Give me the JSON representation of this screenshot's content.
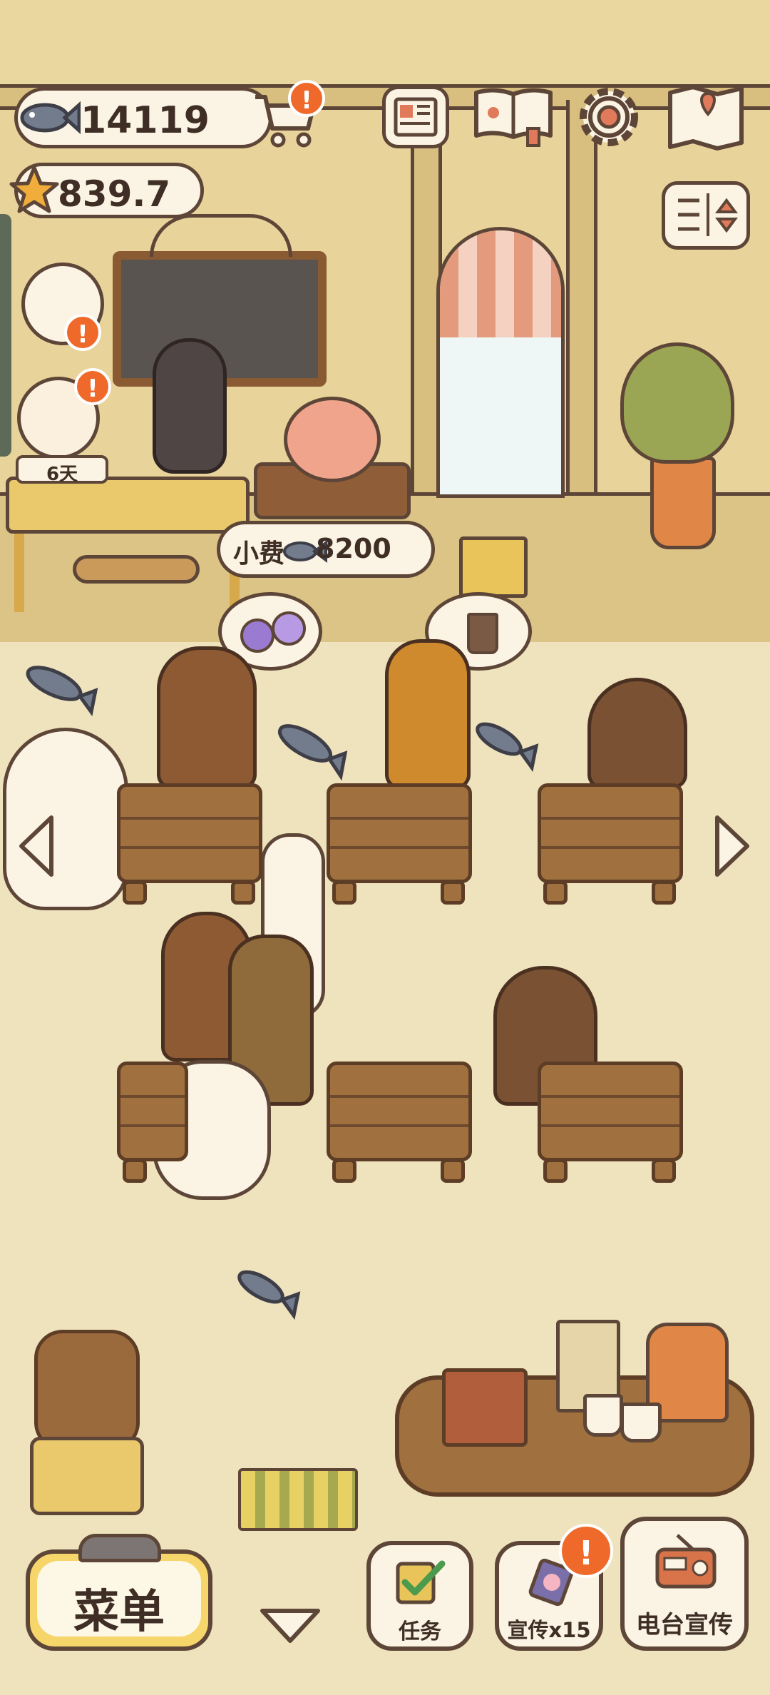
{
  "currency": {
    "fish_count": "14119",
    "stars": "839.7"
  },
  "header_icons": [
    "shop-cart-icon",
    "newspaper-icon",
    "paw-book-icon",
    "gear-icon",
    "map-icon",
    "sort-arrows-icon"
  ],
  "badges": {
    "alert": "!"
  },
  "calendar": {
    "days_label": "6天"
  },
  "tip": {
    "label": "小费",
    "amount": "8200"
  },
  "order_bubbles": [
    "mochi-order-icon",
    "coffee-order-icon"
  ],
  "bottom_bar": {
    "menu_label": "菜单",
    "tasks_label": "任务",
    "promo_label": "宣传x15",
    "radio_label": "电台宣传"
  },
  "colors": {
    "background": "#efe3bd",
    "wall": "#e8d39a",
    "outline": "#5d4637",
    "badge": "#ef6a2a",
    "menu_button": "#f6d66b",
    "wood": "#a0713f"
  }
}
